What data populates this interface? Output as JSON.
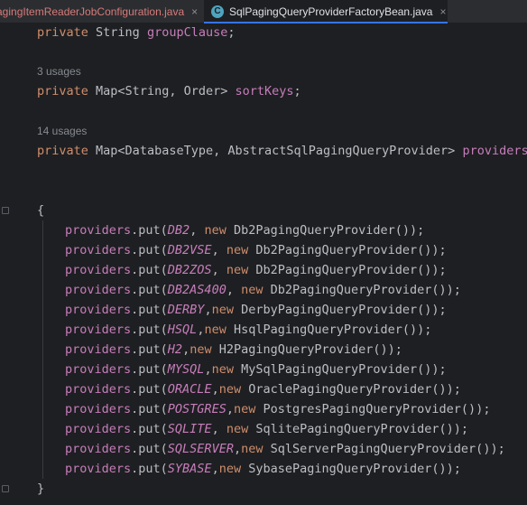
{
  "tabs": [
    {
      "label": "agingItemReaderJobConfiguration.java",
      "close": "×"
    },
    {
      "label": "SqlPagingQueryProviderFactoryBean.java",
      "icon_letter": "C",
      "close": "×",
      "active": true
    }
  ],
  "code": {
    "group_clause": {
      "kw": "private",
      "type": "String",
      "name": "groupClause",
      "end": ";"
    },
    "sort_keys_usages": "3 usages",
    "sort_keys": {
      "kw": "private",
      "type": "Map<String, Order>",
      "name": "sortKeys",
      "end": ";"
    },
    "providers_usages": "14 usages",
    "providers": {
      "kw": "private",
      "type": "Map<DatabaseType, AbstractSqlPagingQueryProvider>",
      "name": "providers",
      "end": " ="
    },
    "open_brace": "{",
    "close_brace": "}",
    "puts": [
      {
        "field": "providers",
        "call": ".put(",
        "const": "DB2",
        "sep": ", ",
        "kw": "new",
        "cls": " Db2PagingQueryProvider());"
      },
      {
        "field": "providers",
        "call": ".put(",
        "const": "DB2VSE",
        "sep": ", ",
        "kw": "new",
        "cls": " Db2PagingQueryProvider());"
      },
      {
        "field": "providers",
        "call": ".put(",
        "const": "DB2ZOS",
        "sep": ", ",
        "kw": "new",
        "cls": " Db2PagingQueryProvider());"
      },
      {
        "field": "providers",
        "call": ".put(",
        "const": "DB2AS400",
        "sep": ", ",
        "kw": "new",
        "cls": " Db2PagingQueryProvider());"
      },
      {
        "field": "providers",
        "call": ".put(",
        "const": "DERBY",
        "sep": ",",
        "kw": "new",
        "cls": " DerbyPagingQueryProvider());"
      },
      {
        "field": "providers",
        "call": ".put(",
        "const": "HSQL",
        "sep": ",",
        "kw": "new",
        "cls": " HsqlPagingQueryProvider());"
      },
      {
        "field": "providers",
        "call": ".put(",
        "const": "H2",
        "sep": ",",
        "kw": "new",
        "cls": " H2PagingQueryProvider());"
      },
      {
        "field": "providers",
        "call": ".put(",
        "const": "MYSQL",
        "sep": ",",
        "kw": "new",
        "cls": " MySqlPagingQueryProvider());"
      },
      {
        "field": "providers",
        "call": ".put(",
        "const": "ORACLE",
        "sep": ",",
        "kw": "new",
        "cls": " OraclePagingQueryProvider());"
      },
      {
        "field": "providers",
        "call": ".put(",
        "const": "POSTGRES",
        "sep": ",",
        "kw": "new",
        "cls": " PostgresPagingQueryProvider());"
      },
      {
        "field": "providers",
        "call": ".put(",
        "const": "SQLITE",
        "sep": ", ",
        "kw": "new",
        "cls": " SqlitePagingQueryProvider());"
      },
      {
        "field": "providers",
        "call": ".put(",
        "const": "SQLSERVER",
        "sep": ",",
        "kw": "new",
        "cls": " SqlServerPagingQueryProvider());"
      },
      {
        "field": "providers",
        "call": ".put(",
        "const": "SYBASE",
        "sep": ",",
        "kw": "new",
        "cls": " SybasePagingQueryProvider());"
      }
    ]
  }
}
